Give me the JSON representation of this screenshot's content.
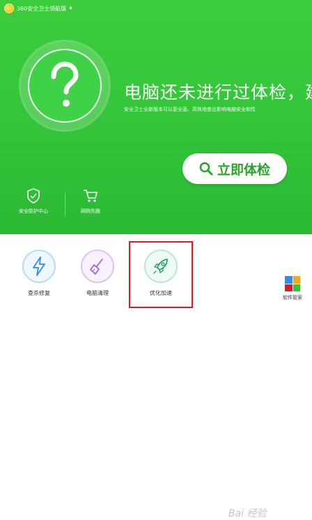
{
  "app": {
    "title": "360安全卫士领航版",
    "title_caret": "♦"
  },
  "hero": {
    "status_icon": "question-mark-icon",
    "headline": "电脑还未进行过体检，建",
    "subline": "安全卫士全新版本可以更全面、高效地查出影响电脑安全和性",
    "check_button_label": "立即体检"
  },
  "quick_links": [
    {
      "label": "安全防护中心",
      "icon": "shield-check-icon"
    },
    {
      "label": "网购先赔",
      "icon": "shopping-cart-icon"
    }
  ],
  "tools": [
    {
      "label": "查杀修复",
      "icon": "lightning-icon",
      "color": "#2f8ee0"
    },
    {
      "label": "电脑清理",
      "icon": "broom-icon",
      "color": "#a463d6"
    },
    {
      "label": "优化加速",
      "icon": "rocket-icon",
      "color": "#22a36a"
    }
  ],
  "manager": {
    "label": "软件管家",
    "icon": "app-grid-icon"
  },
  "watermark": "Bai 经验",
  "colors": {
    "brand_green": "#33c43a",
    "highlight_red": "#e0191f"
  }
}
